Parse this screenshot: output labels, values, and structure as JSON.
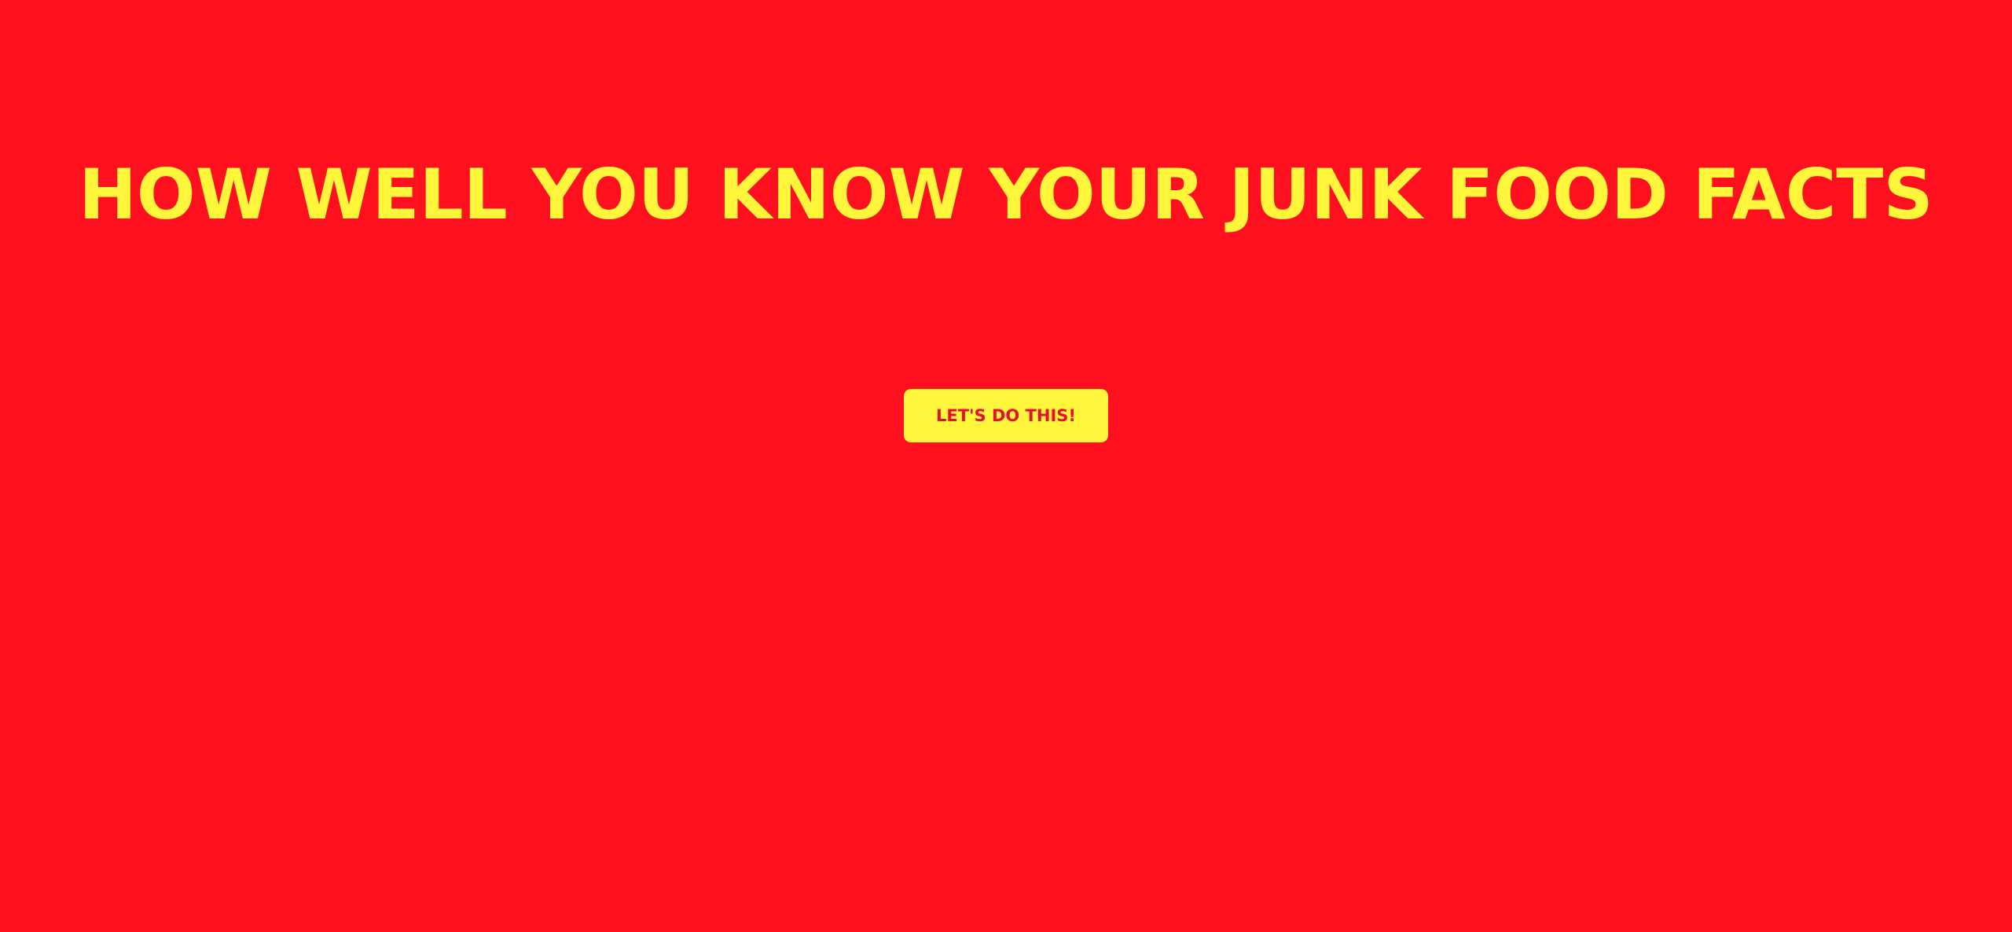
{
  "colors": {
    "background": "#fe101e",
    "accent": "#fff53b",
    "button_text": "#e3122a"
  },
  "hero": {
    "title": "HOW WELL YOU KNOW YOUR JUNK FOOD FACTS",
    "cta_label": "LET'S DO THIS!"
  }
}
